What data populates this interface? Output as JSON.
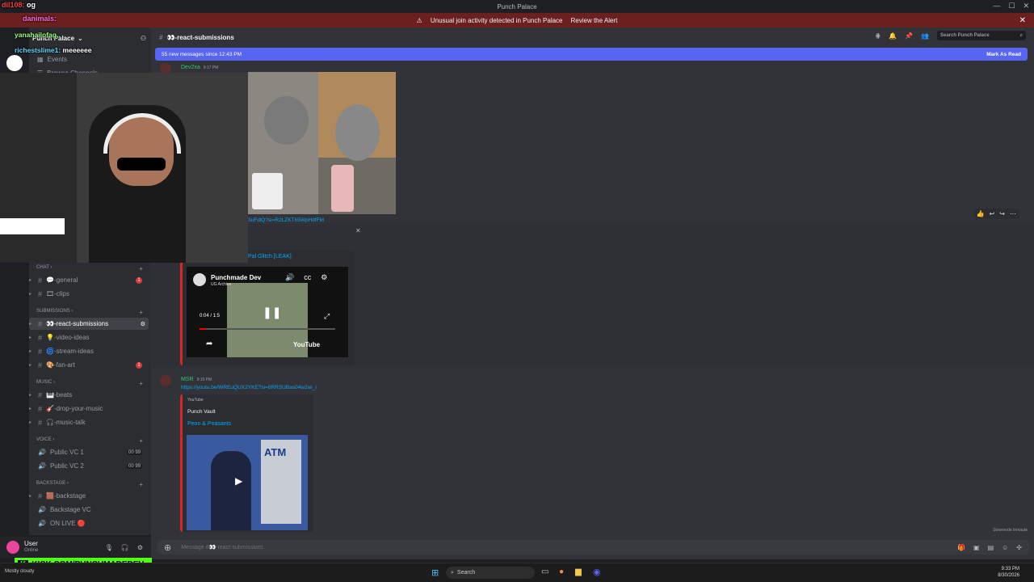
{
  "window": {
    "title": "Punch Palace"
  },
  "alert": {
    "text": "Unusual join activity detected in Punch Palace",
    "action": "Review the Alert"
  },
  "overlay": {
    "line1_user": "dil108:",
    "line1_msg": "og",
    "line2_user": "danimals:",
    "line3_user": "yanahailofag..",
    "line4_user": "richestslime1:",
    "line4_msg": "meeeeee"
  },
  "server": {
    "name": "Punch Palace"
  },
  "sidebar": {
    "top_items": [
      {
        "label": "Events"
      },
      {
        "label": "Browse Channels"
      }
    ],
    "categories": {
      "chat": "CHAT",
      "submissions": "SUBMISSIONS",
      "music": "MUSIC",
      "voice": "VOICE",
      "backstage": "BACKSTAGE"
    },
    "channels": [
      {
        "label": "💬-general",
        "badge": "1"
      },
      {
        "label": "🎞-clips"
      },
      {
        "label": "👀-react-submissions"
      },
      {
        "label": "💡-video-ideas"
      },
      {
        "label": "🌀-stream-ideas"
      },
      {
        "label": "🎨-fan-art",
        "badge": "1"
      },
      {
        "label": "🎹-beats"
      },
      {
        "label": "🎸-drop-your-music"
      },
      {
        "label": "🎧-music-talk"
      },
      {
        "label": "Public VC 1",
        "count": "00 99"
      },
      {
        "label": "Public VC 2",
        "count": "00 99"
      },
      {
        "label": "🟫-backstage"
      },
      {
        "label": "Backstage VC"
      },
      {
        "label": "ON LIVE 🔴"
      }
    ]
  },
  "user": {
    "name": "User",
    "status": "Online"
  },
  "channel": {
    "name": "👀-react-submissions",
    "search_placeholder": "Search Punch Palace"
  },
  "newbar": {
    "text": "55 new messages since 12:43 PM",
    "action": "Mark As Read"
  },
  "messages": [
    {
      "user": "Dev2xa",
      "time": "9:17 PM",
      "link": "3uFdlQ?si=R2LZKTh5WpHdfFM"
    },
    {
      "embed_title": "Pal Glitch [LEAK]",
      "video": {
        "channel": "Punchmade Dev",
        "sub": "UG Archive",
        "time": "0:04 / 1:5",
        "brand": "YouTube"
      }
    },
    {
      "user": "MSR",
      "time": "9:19 PM",
      "link": "https://youtu.be/WREuQUX2YKE?si=8RRSUBas04w2wi_i",
      "embed_site": "YouTube",
      "embed_author": "Punch Vault",
      "embed_title": "Peon & Peasants",
      "thumb_text": "ATM"
    }
  ],
  "slowmode": "Slowmode Inmaute",
  "composer": {
    "placeholder": "Message #👀-react-submissions"
  },
  "kick": {
    "text": "KICK.COM/PUNCHMADEDEV"
  },
  "taskbar": {
    "search": "Search",
    "weather": "Mostly cloudy",
    "time": "9:33 PM",
    "date": "8/30/2026"
  },
  "colors": {
    "accent": "#5865f2",
    "alert": "#6b1f1f",
    "kick": "#53fc18"
  }
}
